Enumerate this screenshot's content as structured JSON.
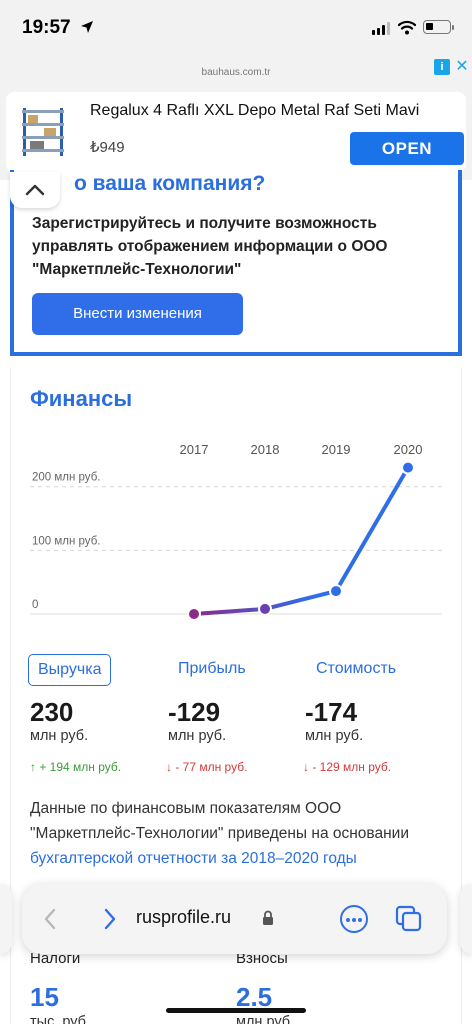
{
  "status_bar": {
    "time": "19:57"
  },
  "ad": {
    "domain": "bauhaus.com.tr",
    "title": "Regalux 4 Raflı XXL Depo Metal Raf Seti Mavi",
    "price": "₺949",
    "open_label": "OPEN",
    "info_glyph": "i",
    "close_glyph": "✕"
  },
  "company_card": {
    "heading": "о ваша компания?",
    "text": "Зарегистрируйтесь и получите возможность управлять отображением информации о ООО \"Маркетплейс-Технологии\"",
    "button_label": "Внести изменения"
  },
  "finance": {
    "title": "Финансы",
    "tabs": [
      {
        "label": "Выручка",
        "active": true
      },
      {
        "label": "Прибыль",
        "active": false
      },
      {
        "label": "Стоимость",
        "active": false
      }
    ],
    "metrics": [
      {
        "value": "230",
        "unit": "млн руб.",
        "change": "↑ + 194 млн руб.",
        "direction": "up"
      },
      {
        "value": "-129",
        "unit": "млн руб.",
        "change": "↓ - 77 млн руб.",
        "direction": "down"
      },
      {
        "value": "-174",
        "unit": "млн руб.",
        "change": "↓ - 129 млн руб.",
        "direction": "down"
      }
    ],
    "description_prefix": "Данные по финансовым показателям ООО \"Маркетплейс-Технологии\" приведены на основании ",
    "description_link": "бухгалтерской отчетности за 2018–2020 годы"
  },
  "chart_data": {
    "type": "line",
    "x": [
      "2017",
      "2018",
      "2019",
      "2020"
    ],
    "y_tick_labels": [
      "200 млн руб.",
      "100 млн руб.",
      "0"
    ],
    "y_ticks": [
      200,
      100,
      0
    ],
    "ylim": [
      0,
      220
    ],
    "series": [
      {
        "values": [
          0,
          8,
          36,
          230
        ]
      }
    ],
    "grid": true,
    "colors": {
      "start": "#8b2a8a",
      "end": "#2f6ee8"
    }
  },
  "bottom": {
    "items": [
      {
        "label": "Налоги",
        "value": "15",
        "unit": "тыс. руб."
      },
      {
        "label": "Взносы",
        "value": "2.5",
        "unit": "млн руб."
      }
    ]
  },
  "safari": {
    "url": "rusprofile.ru"
  },
  "colors": {
    "accent": "#2a6ee0",
    "up": "#3a9d3a",
    "down": "#d43a3a"
  }
}
